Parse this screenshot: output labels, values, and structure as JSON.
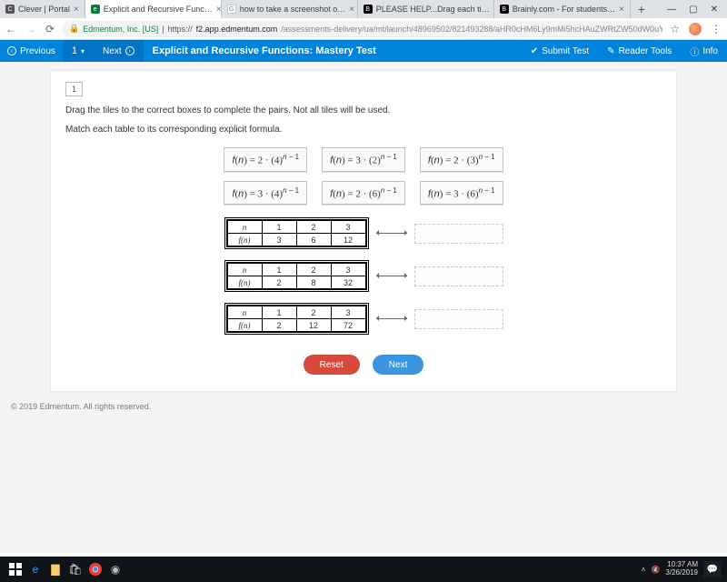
{
  "browser": {
    "tabs": [
      {
        "fav": "C",
        "title": "Clever | Portal"
      },
      {
        "fav": "e",
        "title": "Explicit and Recursive Func…"
      },
      {
        "fav": "G",
        "title": "how to take a screenshot o…"
      },
      {
        "fav": "B",
        "title": "PLEASE HELP...Drag each ti…"
      },
      {
        "fav": "B",
        "title": "Brainly.com - For students…"
      }
    ],
    "url_host": "Edmentum, Inc. [US]",
    "url_prefix": "https://",
    "url_domain": "f2.app.edmentum.com",
    "url_path": "/assessments-delivery/ua/mt/launch/48969502/821493288/aHR0cHM6Ly9mMi5hcHAuZWRtZW50dW0uY29tL2…"
  },
  "appbar": {
    "previous": "Previous",
    "num": "1",
    "next": "Next",
    "title": "Explicit and Recursive Functions: Mastery Test",
    "submit": "Submit Test",
    "reader": "Reader Tools",
    "info": "Info"
  },
  "question": {
    "number": "1",
    "stem": "Drag the tiles to the correct boxes to complete the pairs. Not all tiles will be used.",
    "sub": "Match each table to its corresponding explicit formula.",
    "tiles_row1": [
      "f(n) = 2 · (4)^(n − 1)",
      "f(n) = 3 · (2)^(n − 1)",
      "f(n) = 2 · (3)^(n − 1)"
    ],
    "tiles_row2": [
      "f(n) = 3 · (4)^(n − 1)",
      "f(n) = 2 · (6)^(n − 1)",
      "f(n) = 3 · (6)^(n − 1)"
    ],
    "tables": [
      {
        "n": [
          "1",
          "2",
          "3"
        ],
        "f": [
          "3",
          "6",
          "12"
        ]
      },
      {
        "n": [
          "1",
          "2",
          "3"
        ],
        "f": [
          "2",
          "8",
          "32"
        ]
      },
      {
        "n": [
          "1",
          "2",
          "3"
        ],
        "f": [
          "2",
          "12",
          "72"
        ]
      }
    ],
    "reset": "Reset",
    "next_btn": "Next"
  },
  "footer": "© 2019 Edmentum. All rights reserved.",
  "taskbar": {
    "time": "10:37 AM",
    "date": "3/26/2019"
  },
  "chart_data": {
    "type": "table",
    "description": "Candidate explicit formulas and value tables to match",
    "formulas": [
      {
        "label": "f(n)=2·4^(n-1)",
        "a": 2,
        "r": 4
      },
      {
        "label": "f(n)=3·2^(n-1)",
        "a": 3,
        "r": 2
      },
      {
        "label": "f(n)=2·3^(n-1)",
        "a": 2,
        "r": 3
      },
      {
        "label": "f(n)=3·4^(n-1)",
        "a": 3,
        "r": 4
      },
      {
        "label": "f(n)=2·6^(n-1)",
        "a": 2,
        "r": 6
      },
      {
        "label": "f(n)=3·6^(n-1)",
        "a": 3,
        "r": 6
      }
    ],
    "tables": [
      {
        "n": [
          1,
          2,
          3
        ],
        "f(n)": [
          3,
          6,
          12
        ]
      },
      {
        "n": [
          1,
          2,
          3
        ],
        "f(n)": [
          2,
          8,
          32
        ]
      },
      {
        "n": [
          1,
          2,
          3
        ],
        "f(n)": [
          2,
          12,
          72
        ]
      }
    ]
  }
}
